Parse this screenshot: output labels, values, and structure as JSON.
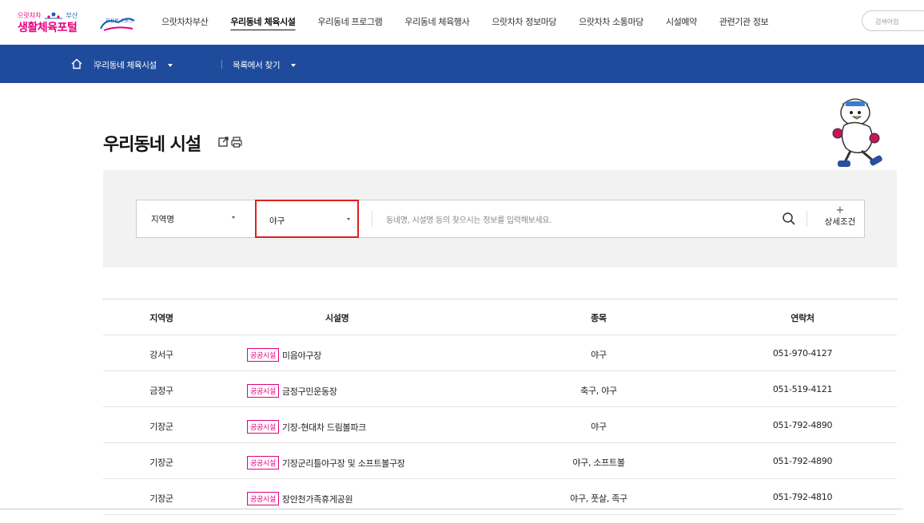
{
  "header": {
    "logo_line1": "으랏차차",
    "logo_line1_city": "부산",
    "logo_line2": "생활체육포털",
    "logo_text": "부산은 스포츠",
    "nav": [
      {
        "label": "으랏차차부산",
        "active": false
      },
      {
        "label": "우리동네 체육시설",
        "active": true
      },
      {
        "label": "우리동네 프로그램",
        "active": false
      },
      {
        "label": "우리동네 체육행사",
        "active": false
      },
      {
        "label": "으랏차차 정보마당",
        "active": false
      },
      {
        "label": "으랏차차 소통마당",
        "active": false
      },
      {
        "label": "시설예약",
        "active": false
      },
      {
        "label": "관련기관 정보",
        "active": false
      }
    ],
    "search_placeholder": "검색어입"
  },
  "breadcrumb": {
    "icon": "home-icon",
    "level1": "우리동네 체육시설",
    "level2": "목록에서 찾기"
  },
  "page": {
    "title": "우리동네 시설"
  },
  "search": {
    "region_label": "지역명",
    "sport_value": "야구",
    "keyword_placeholder": "동네명, 시설명 등의 찾으시는 정보를 입력해보세요.",
    "advanced_plus": "+",
    "advanced_label": "상세조건"
  },
  "table": {
    "headers": [
      "지역명",
      "시설명",
      "종목",
      "연락처"
    ],
    "rows": [
      {
        "region": "강서구",
        "badge": "공공시설",
        "name": "미음야구장",
        "sport": "야구",
        "tel": "051-970-4127"
      },
      {
        "region": "금정구",
        "badge": "공공시설",
        "name": "금정구민운동장",
        "sport": "축구, 야구",
        "tel": "051-519-4121"
      },
      {
        "region": "기장군",
        "badge": "공공시설",
        "name": "기장-현대차 드림볼파크",
        "sport": "야구",
        "tel": "051-792-4890"
      },
      {
        "region": "기장군",
        "badge": "공공시설",
        "name": "기장군리틀야구장 및 소프트볼구장",
        "sport": "야구, 소프트볼",
        "tel": "051-792-4890"
      },
      {
        "region": "기장군",
        "badge": "공공시설",
        "name": "장안천가족휴게공원",
        "sport": "야구, 풋살, 족구",
        "tel": "051-792-4810"
      }
    ]
  },
  "colors": {
    "brand_pink": "#e6007e",
    "nav_blue": "#1e4b9c",
    "highlight_red": "#e0201e"
  }
}
